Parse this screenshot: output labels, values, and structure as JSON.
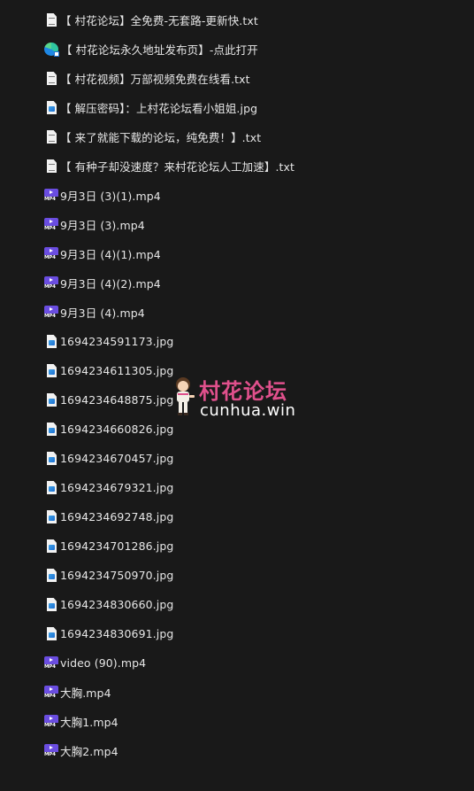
{
  "files": [
    {
      "name": "【 村花论坛】全免费-无套路-更新快.txt",
      "type": "txt",
      "icon": "text-file-icon"
    },
    {
      "name": "【 村花论坛永久地址发布页】-点此打开",
      "type": "url",
      "icon": "edge-shortcut-icon"
    },
    {
      "name": "【 村花视频】万部视频免费在线看.txt",
      "type": "txt",
      "icon": "text-file-icon"
    },
    {
      "name": "【 解压密码】：上村花论坛看小姐姐.jpg",
      "type": "img",
      "icon": "image-file-icon"
    },
    {
      "name": "【 来了就能下载的论坛，纯免费！】.txt",
      "type": "txt",
      "icon": "text-file-icon"
    },
    {
      "name": "【 有种子却没速度？来村花论坛人工加速】.txt",
      "type": "txt",
      "icon": "text-file-icon"
    },
    {
      "name": "9月3日 (3)(1).mp4",
      "type": "mp4",
      "icon": "video-file-icon"
    },
    {
      "name": "9月3日 (3).mp4",
      "type": "mp4",
      "icon": "video-file-icon"
    },
    {
      "name": "9月3日 (4)(1).mp4",
      "type": "mp4",
      "icon": "video-file-icon"
    },
    {
      "name": "9月3日 (4)(2).mp4",
      "type": "mp4",
      "icon": "video-file-icon"
    },
    {
      "name": "9月3日 (4).mp4",
      "type": "mp4",
      "icon": "video-file-icon"
    },
    {
      "name": "1694234591173.jpg",
      "type": "img",
      "icon": "image-file-icon"
    },
    {
      "name": "1694234611305.jpg",
      "type": "img",
      "icon": "image-file-icon"
    },
    {
      "name": "1694234648875.jpg",
      "type": "img",
      "icon": "image-file-icon"
    },
    {
      "name": "1694234660826.jpg",
      "type": "img",
      "icon": "image-file-icon"
    },
    {
      "name": "1694234670457.jpg",
      "type": "img",
      "icon": "image-file-icon"
    },
    {
      "name": "1694234679321.jpg",
      "type": "img",
      "icon": "image-file-icon"
    },
    {
      "name": "1694234692748.jpg",
      "type": "img",
      "icon": "image-file-icon"
    },
    {
      "name": "1694234701286.jpg",
      "type": "img",
      "icon": "image-file-icon"
    },
    {
      "name": "1694234750970.jpg",
      "type": "img",
      "icon": "image-file-icon"
    },
    {
      "name": "1694234830660.jpg",
      "type": "img",
      "icon": "image-file-icon"
    },
    {
      "name": "1694234830691.jpg",
      "type": "img",
      "icon": "image-file-icon"
    },
    {
      "name": "video (90).mp4",
      "type": "mp4",
      "icon": "video-file-icon"
    },
    {
      "name": "大胸.mp4",
      "type": "mp4",
      "icon": "video-file-icon"
    },
    {
      "name": "大胸1.mp4",
      "type": "mp4",
      "icon": "video-file-icon"
    },
    {
      "name": "大胸2.mp4",
      "type": "mp4",
      "icon": "video-file-icon"
    }
  ],
  "video_icon_label": "MP4",
  "watermark": {
    "title": "村花论坛",
    "url": "cunhua.win",
    "title_color": "#e0508c"
  },
  "colors": {
    "background": "#191919",
    "text": "#e6e6e6",
    "video_accent": "#6a4de0"
  }
}
